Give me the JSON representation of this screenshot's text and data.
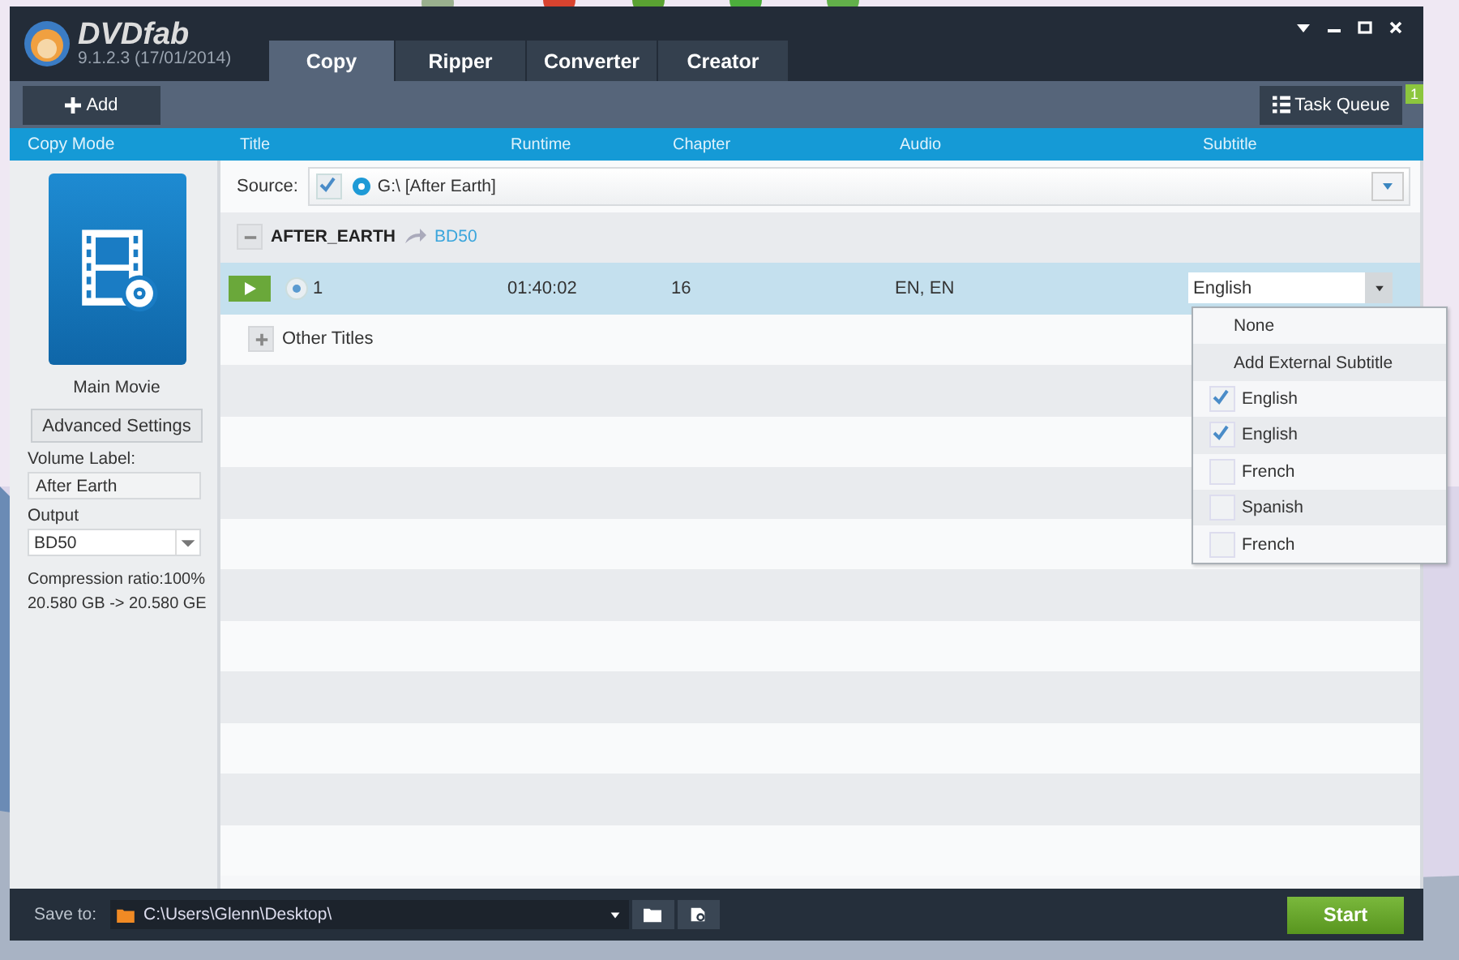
{
  "app": {
    "name": "DVDfab",
    "version": "9.1.2.3 (17/01/2014)"
  },
  "tabs": [
    {
      "label": "Copy",
      "selected": true
    },
    {
      "label": "Ripper",
      "selected": false
    },
    {
      "label": "Converter",
      "selected": false
    },
    {
      "label": "Creator",
      "selected": false
    }
  ],
  "toolbar": {
    "add": "Add",
    "task_queue": "Task Queue",
    "task_badge": "1"
  },
  "columns": [
    "Copy Mode",
    "Title",
    "Runtime",
    "Chapter",
    "Audio",
    "Subtitle"
  ],
  "sidebar": {
    "mode": "Main Movie",
    "advanced": "Advanced Settings",
    "volume_label": "Volume Label:",
    "volume_value": "After Earth",
    "output_label": "Output",
    "output_value": "BD50",
    "compression": "Compression ratio:100%",
    "size": "20.580 GB -> 20.580 GE"
  },
  "source": {
    "label": "Source:",
    "checked": true,
    "value": "G:\\ [After Earth]"
  },
  "disc": {
    "name": "AFTER_EARTH",
    "target": "BD50",
    "expanded": true
  },
  "titles": [
    {
      "number": "1",
      "runtime": "01:40:02",
      "chapter": "16",
      "audio": "EN, EN",
      "subtitle": "English",
      "selected": true
    }
  ],
  "other_titles": {
    "label": "Other Titles",
    "expanded": false
  },
  "subtitle_menu": [
    {
      "kind": "action",
      "label": "None"
    },
    {
      "kind": "action",
      "label": "Add External Subtitle"
    },
    {
      "kind": "check",
      "label": "English",
      "checked": true
    },
    {
      "kind": "check",
      "label": "English",
      "checked": true
    },
    {
      "kind": "check",
      "label": "French",
      "checked": false
    },
    {
      "kind": "check",
      "label": "Spanish",
      "checked": false
    },
    {
      "kind": "check",
      "label": "French",
      "checked": false
    }
  ],
  "footer": {
    "save_label": "Save to:",
    "path": "C:\\Users\\Glenn\\Desktop\\",
    "start": "Start"
  }
}
